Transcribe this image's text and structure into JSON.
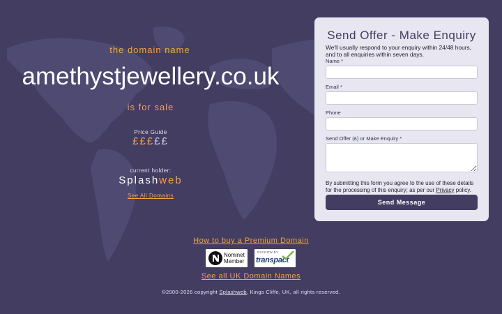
{
  "colors": {
    "background": "#423d61",
    "accent": "#f2a63d",
    "card": "#e7e6f1",
    "button": "#423d61"
  },
  "hero": {
    "intro": "the domain name",
    "domain": "amethystjewellery.co.uk",
    "for_sale": "is for sale"
  },
  "price_guide": {
    "label": "Price Guide",
    "symbol": "£",
    "filled": 3,
    "total": 5
  },
  "holder": {
    "label": "current holder:",
    "logo_part1": "Splash",
    "logo_part2": "web",
    "see_all": "See All Domains"
  },
  "form": {
    "title": "Send Offer - Make Enquiry",
    "description": "We'll usually respond to your enquiry within 24/48 hours, and to all enquiries within seven days.",
    "fields": {
      "name_label": "Name *",
      "email_label": "Email *",
      "phone_label": "Phone",
      "offer_label": "Send Offer (£) or Make Enquiry *"
    },
    "consent_before": "By submitting this form you agree to the use of these details for the processing of this enquiry; as per our ",
    "consent_link": "Privacy",
    "consent_after": " policy.",
    "submit": "Send Message"
  },
  "bottom": {
    "how_to_buy": "How to buy a Premium Domain",
    "nominet_line1": "Nominet",
    "nominet_line2": "Member",
    "escrow_label": "ESCROW BY",
    "transpact": "transpact",
    "see_all_uk": "See all UK Domain Names"
  },
  "footer": {
    "before": "©2000-2026 copyright ",
    "link": "Splashweb",
    "after": ", Kings Cliffe, UK, all rights reserved."
  },
  "icons": {
    "nominet": "nominet-n-icon",
    "transpact": "transpact-check-icon",
    "map": "world-map"
  }
}
